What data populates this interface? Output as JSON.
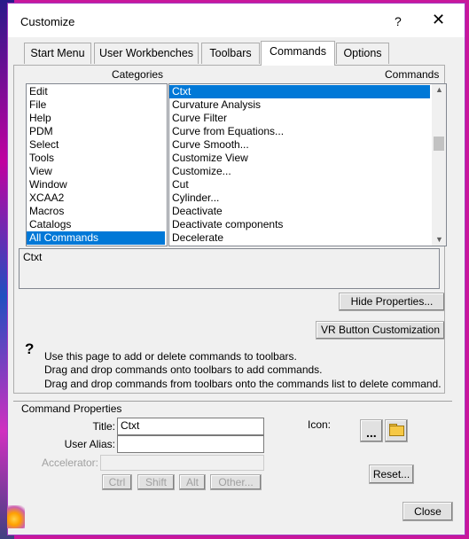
{
  "window": {
    "title": "Customize",
    "help_glyph": "?",
    "close_glyph": "✕"
  },
  "tabs": [
    {
      "label": "Start Menu"
    },
    {
      "label": "User Workbenches"
    },
    {
      "label": "Toolbars"
    },
    {
      "label": "Commands",
      "active": true
    },
    {
      "label": "Options"
    }
  ],
  "categories": {
    "label": "Categories",
    "items": [
      "Edit",
      "File",
      "Help",
      "PDM",
      "Select",
      "Tools",
      "View",
      "Window",
      "XCAA2",
      "Macros",
      "Catalogs",
      "All Commands"
    ],
    "selected": "All Commands"
  },
  "commands": {
    "label": "Commands",
    "items": [
      "Ctxt",
      "Curvature Analysis",
      "Curve Filter",
      "Curve from Equations...",
      "Curve Smooth...",
      "Customize View",
      "Customize...",
      "Cut",
      "Cylinder...",
      "Deactivate",
      "Deactivate components",
      "Decelerate"
    ],
    "selected": "Ctxt"
  },
  "description": {
    "text": "Ctxt"
  },
  "buttons": {
    "hide_properties": "Hide Properties...",
    "vr_button": "VR Button Customization",
    "reset": "Reset...",
    "close": "Close"
  },
  "help": {
    "lines": [
      "Use this page to add or delete commands to toolbars.",
      "Drag and drop commands onto toolbars to add commands.",
      "Drag and drop commands from toolbars onto the commands list to delete command."
    ]
  },
  "properties": {
    "section_label": "Command Properties",
    "title_label": "Title:",
    "title_value": "Ctxt",
    "alias_label": "User Alias:",
    "alias_value": "",
    "accelerator_label": "Accelerator:",
    "accelerator_value": "",
    "modifiers": [
      "Ctrl",
      "Shift",
      "Alt",
      "Other..."
    ],
    "icon_label": "Icon:",
    "icon_dots": "..."
  },
  "colors": {
    "selection": "#0078d7",
    "desktop": "#c8179b"
  }
}
